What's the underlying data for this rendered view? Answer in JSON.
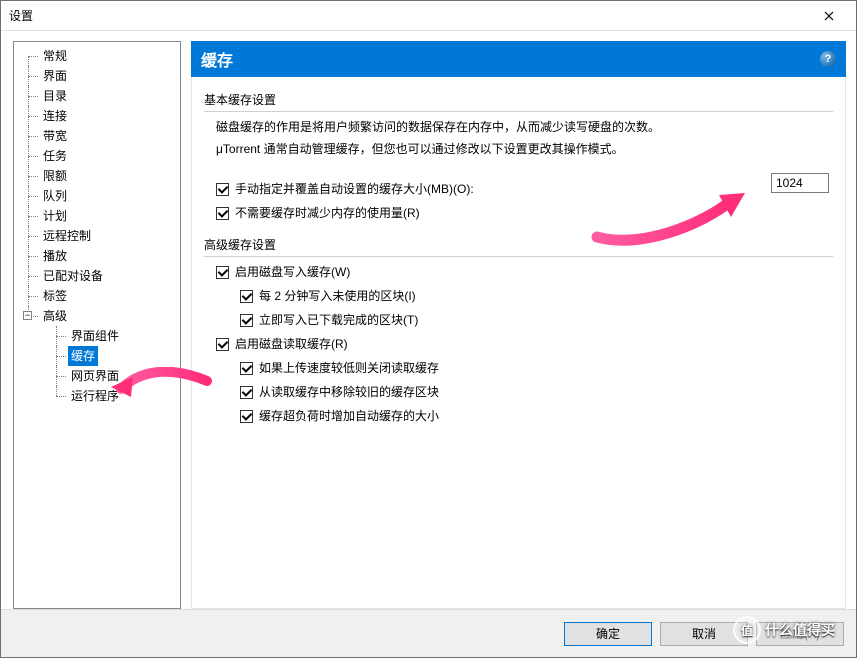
{
  "window": {
    "title": "设置"
  },
  "tree": {
    "items": [
      "常规",
      "界面",
      "目录",
      "连接",
      "带宽",
      "任务",
      "限额",
      "队列",
      "计划",
      "远程控制",
      "播放",
      "已配对设备",
      "标签"
    ],
    "advanced": {
      "label": "高级",
      "children": [
        "界面组件",
        "缓存",
        "网页界面",
        "运行程序"
      ],
      "selected_index": 1
    }
  },
  "panel": {
    "title": "缓存",
    "basic": {
      "legend": "基本缓存设置",
      "desc1": "磁盘缓存的作用是将用户频繁访问的数据保存在内存中，从而减少读写硬盘的次数。",
      "desc2": "μTorrent 通常自动管理缓存，但您也可以通过修改以下设置更改其操作模式。",
      "cb_manual": "手动指定并覆盖自动设置的缓存大小(MB)(O):",
      "cache_value": "1024",
      "cb_reduce": "不需要缓存时减少内存的使用量(R)"
    },
    "advanced": {
      "legend": "高级缓存设置",
      "cb_write": "启用磁盘写入缓存(W)",
      "cb_write_every2": "每 2 分钟写入未使用的区块(I)",
      "cb_write_immediate": "立即写入已下载完成的区块(T)",
      "cb_read": "启用磁盘读取缓存(R)",
      "cb_read_slowup": "如果上传速度较低则关闭读取缓存",
      "cb_read_purge": "从读取缓存中移除较旧的缓存区块",
      "cb_read_grow": "缓存超负荷时增加自动缓存的大小"
    }
  },
  "buttons": {
    "ok": "确定",
    "cancel": "取消",
    "apply": "应用(A)"
  },
  "watermark": {
    "text": "什么值得买",
    "badge": "值"
  }
}
